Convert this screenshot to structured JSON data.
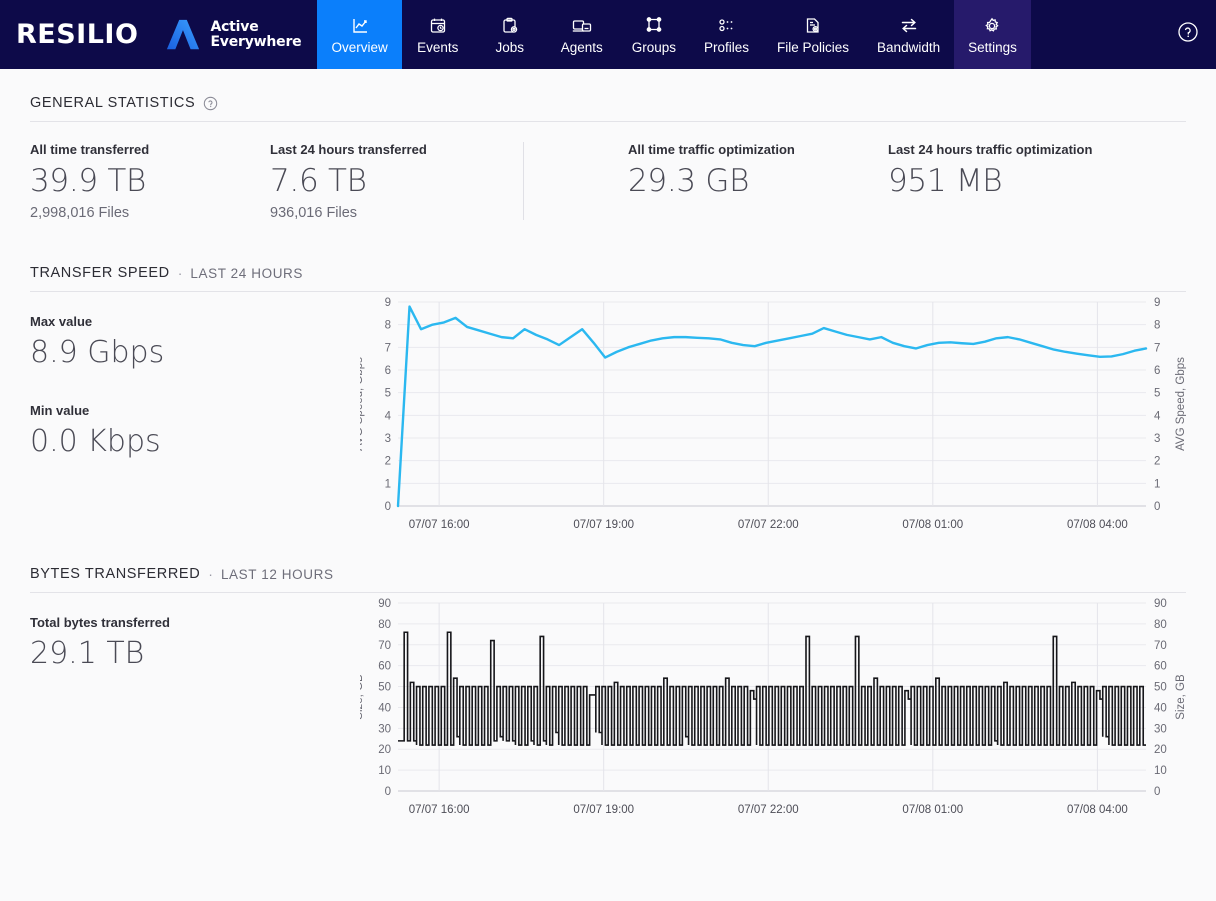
{
  "brand": {
    "name": "RESILIO",
    "tagline_line1": "Active",
    "tagline_line2": "Everywhere",
    "logo_icon": "resilio-a-mark-icon"
  },
  "nav": {
    "items": [
      {
        "label": "Overview",
        "icon": "chart-line-in-frame-icon",
        "active": true
      },
      {
        "label": "Events",
        "icon": "calendar-clock-icon",
        "active": false
      },
      {
        "label": "Jobs",
        "icon": "clipboard-gear-icon",
        "active": false
      },
      {
        "label": "Agents",
        "icon": "devices-icon",
        "active": false
      },
      {
        "label": "Groups",
        "icon": "nodes-square-icon",
        "active": false
      },
      {
        "label": "Profiles",
        "icon": "list-dots-icon",
        "active": false
      },
      {
        "label": "File Policies",
        "icon": "document-gear-icon",
        "active": false
      },
      {
        "label": "Bandwidth",
        "icon": "arrows-exchange-icon",
        "active": false
      },
      {
        "label": "Settings",
        "icon": "gear-icon",
        "active": false
      }
    ],
    "help": {
      "label": "?",
      "icon": "help-circle-icon"
    },
    "active_color": "#0b7ffb",
    "bar_color": "#0d0a49",
    "settings_color": "#261a6b"
  },
  "general_statistics": {
    "title": "GENERAL STATISTICS",
    "help_icon": "help-circle-icon",
    "stats": [
      {
        "label": "All time transferred",
        "value": "39.9 TB",
        "sub": "2,998,016 Files"
      },
      {
        "label": "Last 24 hours transferred",
        "value": "7.6 TB",
        "sub": "936,016 Files"
      },
      {
        "label": "All time traffic optimization",
        "value": "29.3 GB",
        "sub": ""
      },
      {
        "label": "Last 24 hours traffic optimization",
        "value": "951 MB",
        "sub": ""
      }
    ]
  },
  "transfer_speed": {
    "title": "TRANSFER SPEED",
    "separator": "·",
    "subtitle": "LAST 24 HOURS",
    "max_label": "Max value",
    "max_value": "8.9 Gbps",
    "min_label": "Min value",
    "min_value": "0.0 Kbps"
  },
  "bytes_transferred": {
    "title": "BYTES TRANSFERRED",
    "separator": "·",
    "subtitle": "LAST 12 HOURS",
    "total_label": "Total bytes transferred",
    "total_value": "29.1 TB"
  },
  "chart_data": [
    {
      "id": "transfer-speed-chart",
      "type": "line",
      "title": "TRANSFER SPEED",
      "subtitle": "LAST 24 HOURS",
      "ylabel": "AVG Speed, Gbps",
      "ylabel_right": "AVG Speed, Gbps",
      "xlabel": "",
      "ylim": [
        0,
        9
      ],
      "yticks": [
        0,
        1,
        2,
        3,
        4,
        5,
        6,
        7,
        8,
        9
      ],
      "grid": true,
      "legend": "none",
      "line_color": "#2bb8f0",
      "xtick_labels": [
        "07/07 16:00",
        "07/07 19:00",
        "07/07 22:00",
        "07/08 01:00",
        "07/08 04:00"
      ],
      "xtick_positions": [
        0.055,
        0.275,
        0.495,
        0.715,
        0.935
      ],
      "values": [
        0.0,
        8.8,
        7.8,
        8.0,
        8.1,
        8.3,
        7.9,
        7.75,
        7.6,
        7.45,
        7.4,
        7.8,
        7.55,
        7.35,
        7.1,
        7.45,
        7.8,
        7.2,
        6.55,
        6.8,
        7.0,
        7.15,
        7.3,
        7.4,
        7.45,
        7.45,
        7.42,
        7.4,
        7.35,
        7.2,
        7.1,
        7.05,
        7.2,
        7.3,
        7.4,
        7.5,
        7.6,
        7.85,
        7.7,
        7.55,
        7.45,
        7.35,
        7.45,
        7.2,
        7.05,
        6.95,
        7.1,
        7.2,
        7.22,
        7.18,
        7.15,
        7.25,
        7.4,
        7.45,
        7.35,
        7.2,
        7.05,
        6.9,
        6.8,
        6.72,
        6.65,
        6.58,
        6.6,
        6.7,
        6.85,
        6.95
      ]
    },
    {
      "id": "bytes-transferred-chart",
      "type": "bar",
      "title": "BYTES TRANSFERRED",
      "subtitle": "LAST 12 HOURS",
      "ylabel": "Size, GB",
      "ylabel_right": "Size, GB",
      "xlabel": "",
      "ylim": [
        0,
        90
      ],
      "yticks": [
        0,
        10,
        20,
        30,
        40,
        50,
        60,
        70,
        80,
        90
      ],
      "grid": true,
      "legend": "none",
      "bar_color": "#16161a",
      "bar_style": "outline",
      "baseline": 22,
      "xtick_labels": [
        "07/07 16:00",
        "07/07 19:00",
        "07/07 22:00",
        "07/08 01:00",
        "07/08 04:00"
      ],
      "xtick_positions": [
        0.055,
        0.275,
        0.495,
        0.715,
        0.935
      ],
      "values": [
        24,
        76,
        52,
        50,
        50,
        50,
        50,
        50,
        76,
        54,
        50,
        50,
        50,
        50,
        50,
        72,
        50,
        50,
        50,
        50,
        50,
        50,
        50,
        74,
        50,
        50,
        50,
        50,
        50,
        50,
        50,
        46,
        50,
        50,
        50,
        52,
        50,
        50,
        50,
        50,
        50,
        50,
        50,
        54,
        50,
        50,
        50,
        50,
        50,
        50,
        50,
        50,
        50,
        54,
        50,
        50,
        50,
        48,
        50,
        50,
        50,
        50,
        50,
        50,
        50,
        50,
        74,
        50,
        50,
        50,
        50,
        50,
        50,
        50,
        74,
        50,
        50,
        54,
        50,
        50,
        50,
        50,
        48,
        50,
        50,
        50,
        50,
        54,
        50,
        50,
        50,
        50,
        50,
        50,
        50,
        50,
        50,
        50,
        52,
        50,
        50,
        50,
        50,
        50,
        50,
        50,
        74,
        50,
        50,
        52,
        50,
        50,
        50,
        48,
        50,
        50,
        50,
        50,
        50,
        50,
        50
      ],
      "lows": [
        24,
        24,
        24,
        22,
        22,
        22,
        22,
        22,
        22,
        26,
        22,
        22,
        22,
        22,
        22,
        24,
        26,
        24,
        24,
        22,
        22,
        24,
        22,
        24,
        22,
        28,
        22,
        22,
        22,
        22,
        22,
        46,
        28,
        22,
        22,
        22,
        22,
        22,
        22,
        22,
        22,
        22,
        22,
        22,
        22,
        22,
        26,
        22,
        22,
        22,
        22,
        22,
        22,
        22,
        22,
        22,
        22,
        44,
        22,
        22,
        22,
        22,
        22,
        22,
        22,
        22,
        22,
        22,
        22,
        22,
        22,
        22,
        22,
        22,
        22,
        22,
        22,
        22,
        22,
        22,
        22,
        22,
        44,
        22,
        22,
        22,
        22,
        22,
        22,
        22,
        22,
        22,
        22,
        22,
        22,
        22,
        24,
        22,
        22,
        22,
        22,
        22,
        22,
        22,
        22,
        22,
        22,
        22,
        22,
        22,
        22,
        22,
        22,
        44,
        26,
        22,
        22,
        22,
        22,
        22,
        22
      ]
    }
  ]
}
